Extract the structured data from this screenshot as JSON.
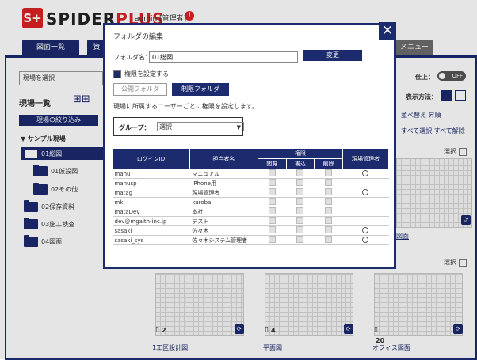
{
  "header": {
    "logo_mark": "S+",
    "logo_text": "SPIDER",
    "logo_text_accent": "PLUS",
    "user": "admin [管理者]",
    "alert_icon": "alert-circle-icon"
  },
  "tabs": [
    {
      "label": "図面一覧"
    },
    {
      "label": "資"
    },
    {
      "label": "メニュー"
    }
  ],
  "left_panel": {
    "site_select_value": "現場を選択",
    "title": "現場一覧",
    "filter_button": "現場の絞り込み",
    "tree_root": "サンプル現場",
    "tree": [
      {
        "label": "01総図",
        "level": 0,
        "open": true,
        "selected": true
      },
      {
        "label": "01仮設図",
        "level": 1
      },
      {
        "label": "02その他",
        "level": 1
      },
      {
        "label": "02保存資料",
        "level": 0
      },
      {
        "label": "03施工検査",
        "level": 0
      },
      {
        "label": "04図面",
        "level": 0
      }
    ]
  },
  "right_panel": {
    "finish_label": "仕上：",
    "toggle_label": "OFF",
    "display_label": "表示方法：",
    "sort_links": "並べ替え 昇順",
    "select_links": "すべて選択 すべて解除",
    "select_label_1": "選択",
    "select_label_2": "選択"
  },
  "thumbnails": [
    {
      "num": "2",
      "name": "1工区設計図"
    },
    {
      "num": "4",
      "name": "平面図"
    },
    {
      "num": "20",
      "name": "オフィス図面"
    },
    {
      "num": "",
      "name": "図面"
    }
  ],
  "modal": {
    "title": "フォルダの編集",
    "name_label": "フォルダ名：",
    "name_value": "01総図",
    "change_button": "変更",
    "perm_checkbox": "権限を設定する",
    "btn_public": "公開フォルダ",
    "btn_limited": "制限フォルダ",
    "limited_desc": "現場に所属するユーザーごとに権限を設定します。",
    "group_label": "グループ：",
    "group_value": "選択",
    "close_icon": "close-icon",
    "table": {
      "headers": {
        "login": "ログインID",
        "name": "担当者名",
        "perm_group": "権限",
        "read": "閲覧",
        "write": "書込",
        "delete": "削除",
        "admin": "現場管理者"
      },
      "rows": [
        {
          "login": "manu",
          "name": "マニュアル",
          "admin": true
        },
        {
          "login": "manusp",
          "name": "iPhone用",
          "admin": false
        },
        {
          "login": "matag",
          "name": "現場管理者",
          "admin": true
        },
        {
          "login": "mk",
          "name": "kuroba",
          "admin": false
        },
        {
          "login": "mataDev",
          "name": "本社",
          "admin": false
        },
        {
          "login": "dev@mgaith-inc.jp",
          "name": "テスト",
          "admin": false
        },
        {
          "login": "sasaki",
          "name": "佐々木",
          "admin": true
        },
        {
          "login": "sasaki_sys",
          "name": "佐々木システム管理者",
          "admin": true
        }
      ]
    }
  },
  "colors": {
    "brand_navy": "#1c2a6e",
    "logo_red": "#dd2222"
  }
}
